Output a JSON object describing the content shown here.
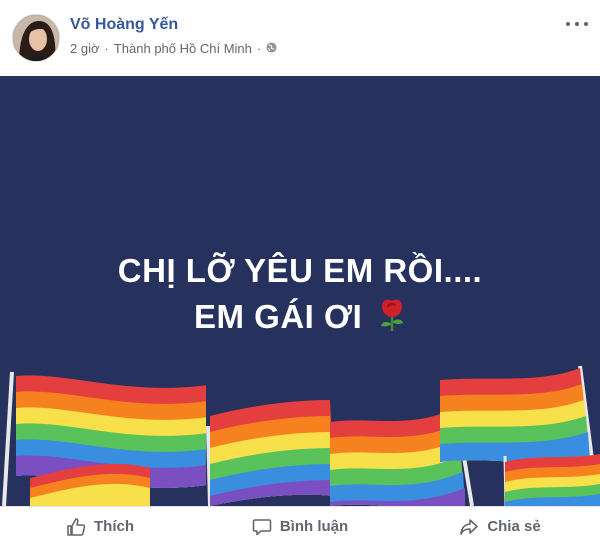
{
  "post": {
    "author": "Võ Hoàng Yến",
    "time": "2 giờ",
    "separator": "·",
    "location": "Thành phố Hồ Chí Minh",
    "location_suffix": "·",
    "privacy_icon": "globe-icon",
    "more_icon": "more-options-icon"
  },
  "image": {
    "line1": "CHỊ LỠ YÊU EM RỒI....",
    "line2": "EM GÁI ƠI",
    "emoji": "rose-icon",
    "background_color": "#26315e",
    "flag_colors": [
      "#e53e3e",
      "#f6821f",
      "#f7e04a",
      "#59c25a",
      "#3a8ee0",
      "#7a4fc2"
    ]
  },
  "actions": {
    "like": "Thích",
    "comment": "Bình luận",
    "share": "Chia sẻ"
  },
  "colors": {
    "author_link": "#365899",
    "meta_text": "#606770"
  }
}
